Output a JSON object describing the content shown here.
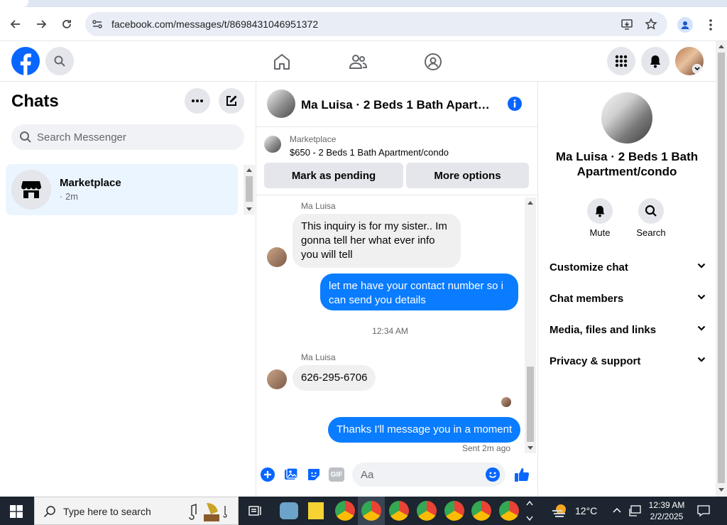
{
  "browser": {
    "url": "facebook.com/messages/t/8698431046951372"
  },
  "fb_header": {
    "logo": "facebook-logo"
  },
  "chats": {
    "title": "Chats",
    "search_placeholder": "Search Messenger",
    "items": [
      {
        "name": "Marketplace",
        "meta": "· 2m"
      }
    ]
  },
  "conversation": {
    "title": "Ma Luisa · 2 Beds 1 Bath Apartme...",
    "marketplace_label": "Marketplace",
    "listing": "$650 - 2 Beds 1 Bath Apartment/condo",
    "mark_pending_label": "Mark as pending",
    "more_options_label": "More options",
    "messages": {
      "sender1": "Ma Luisa",
      "msg1_line1": "This inquiry is for my sister.. Im",
      "msg1_line2": "gonna tell her what ever info",
      "msg1_line3": "you will tell",
      "msg2_line1": "let me have your contact number so i",
      "msg2_line2": "can send you details",
      "timestamp": "12:34 AM",
      "sender2": "Ma Luisa",
      "msg3": "626-295-6706",
      "msg4": "Thanks I'll message you in a moment",
      "sent_status": "Sent 2m ago"
    },
    "composer_placeholder": "Aa"
  },
  "details": {
    "name_line1": "Ma Luisa · 2 Beds 1 Bath",
    "name_line2": "Apartment/condo",
    "mute_label": "Mute",
    "search_label": "Search",
    "sections": [
      "Customize chat",
      "Chat members",
      "Media, files and links",
      "Privacy & support"
    ]
  },
  "taskbar": {
    "search_placeholder": "Type here to search",
    "weather": "12°C",
    "time": "12:39 AM",
    "date": "2/2/2025"
  },
  "colors": {
    "fb_blue": "#0866ff",
    "bubble_out": "#0a7cff",
    "selected_chat": "#ebf5ff"
  }
}
